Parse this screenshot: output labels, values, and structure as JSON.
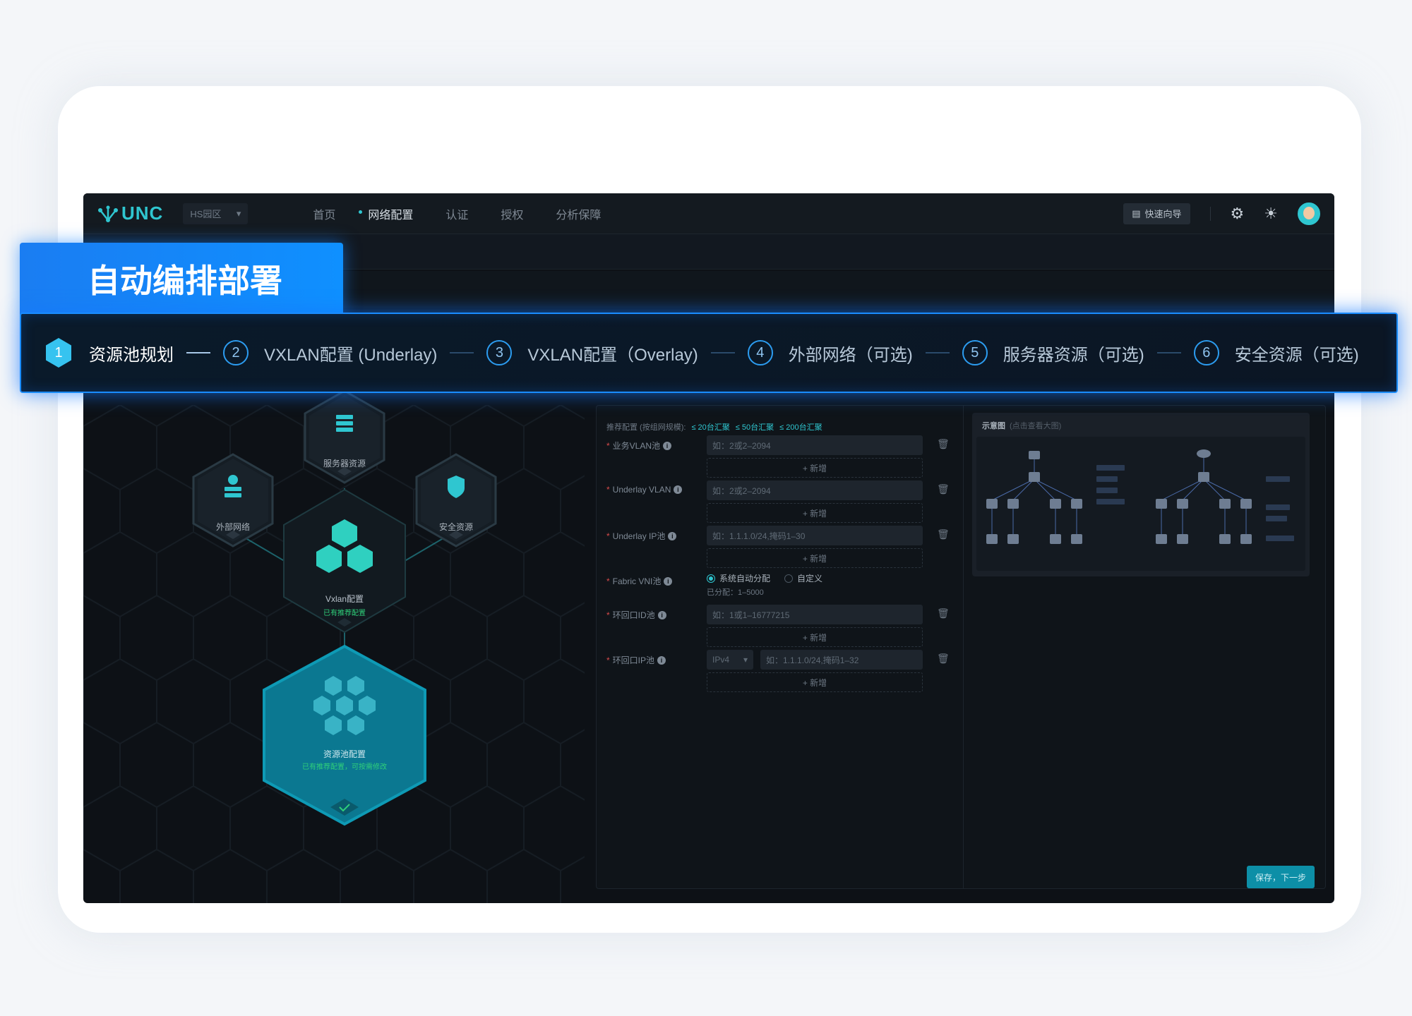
{
  "banner": {
    "title": "自动编排部署"
  },
  "steps": [
    {
      "num": "1",
      "label": "资源池规划",
      "active": true
    },
    {
      "num": "2",
      "label": "VXLAN配置 (Underlay)"
    },
    {
      "num": "3",
      "label": "VXLAN配置（Overlay)"
    },
    {
      "num": "4",
      "label": "外部网络（可选)"
    },
    {
      "num": "5",
      "label": "服务器资源（可选)"
    },
    {
      "num": "6",
      "label": "安全资源（可选)"
    }
  ],
  "topnav": {
    "logo": "UNC",
    "campus": "HS园区",
    "items": [
      "首页",
      "网络配置",
      "认证",
      "授权",
      "分析保障"
    ],
    "active_item": "网络配置",
    "guide_button": "快速向导"
  },
  "hexes": {
    "server": "服务器资源",
    "external": "外部网络",
    "security": "安全资源",
    "vxlan": {
      "title": "Vxlan配置",
      "status": "已有推荐配置"
    },
    "pool": {
      "title": "资源池配置",
      "status": "已有推荐配置，可按需修改"
    }
  },
  "form": {
    "recommend_label": "推荐配置 (按组网规模):",
    "recommend_tags": [
      "≤ 20台汇聚",
      "≤ 50台汇聚",
      "≤ 200台汇聚"
    ],
    "add_label": "+ 新增",
    "fields": [
      {
        "label": "业务VLAN池",
        "placeholder": "如：2或2–2094"
      },
      {
        "label": "Underlay VLAN",
        "placeholder": "如：2或2–2094"
      },
      {
        "label": "Underlay IP池",
        "placeholder": "如：1.1.1.0/24,掩码1–30"
      },
      {
        "label": "环回口ID池",
        "placeholder": "如：1或1–16777215"
      },
      {
        "label": "环回口IP池",
        "placeholder": "如：1.1.1.0/24,掩码1–32",
        "select": "IPv4"
      }
    ],
    "vni": {
      "label": "Fabric VNI池",
      "option_auto": "系统自动分配",
      "option_custom": "自定义",
      "allocated": "已分配：1–5000"
    },
    "diagram_title": "示意图",
    "diagram_hint": "(点击查看大图)",
    "save_button": "保存，下一步"
  },
  "colors": {
    "accent": "#2fc6d0",
    "banner_blue": "#1a7df2",
    "app_bg": "#0d1116"
  }
}
